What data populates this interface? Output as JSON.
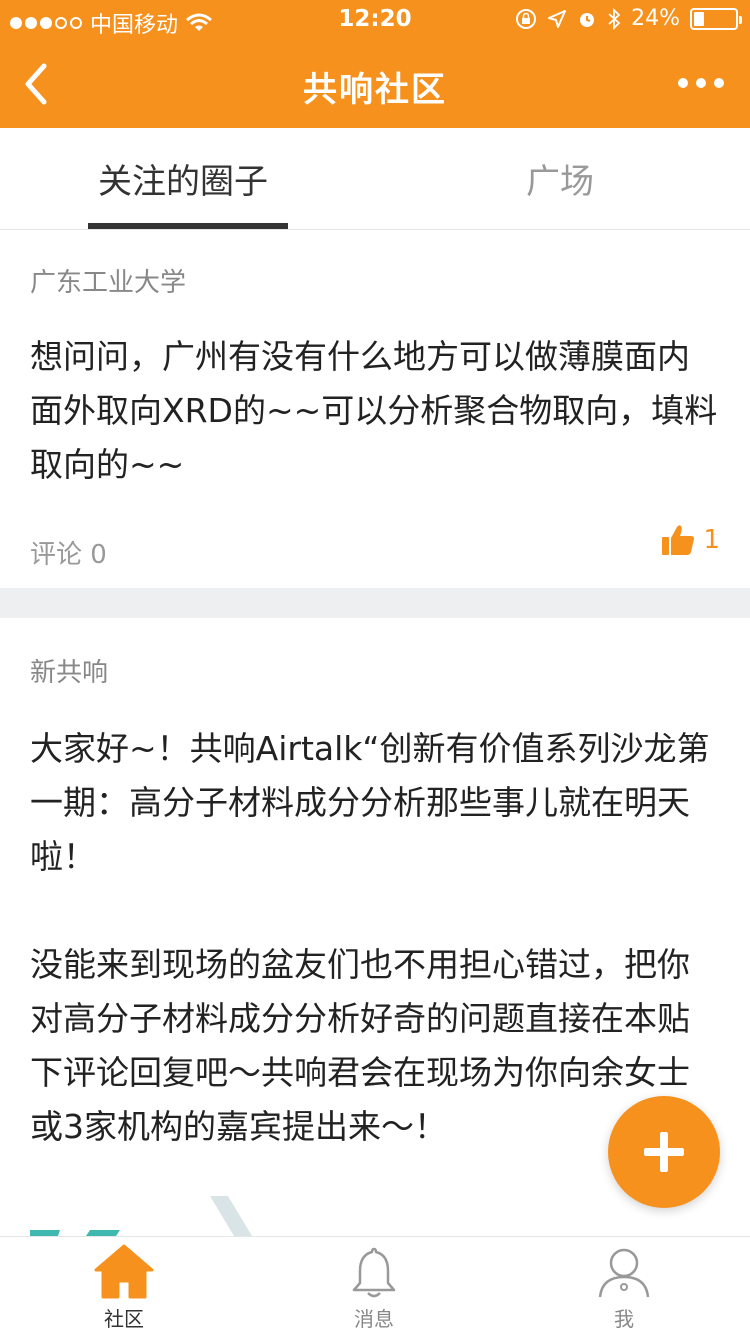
{
  "status_bar": {
    "carrier": "中国移动",
    "time": "12:20",
    "battery": "24%",
    "battery_level": 0.24
  },
  "header": {
    "title": "共响社区"
  },
  "tabs": [
    {
      "label": "关注的圈子",
      "active": true
    },
    {
      "label": "广场",
      "active": false
    }
  ],
  "posts": [
    {
      "circle": "广东工业大学",
      "paragraphs": [
        "想问问，广州有没有什么地方可以做薄膜面内面外取向XRD的~~可以分析聚合物取向，填料取向的~~"
      ],
      "comments": "评论 0",
      "likes": "1"
    },
    {
      "circle": "新共响",
      "paragraphs": [
        "大家好~！共响Airtalk“创新有价值系列沙龙第一期：高分子材料成分分析那些事儿就在明天啦！",
        "没能来到现场的盆友们也不用担心错过，把你对高分子材料成分分析好奇的问题直接在本贴下评论回复吧～共响君会在现场为你向余女士或3家机构的嘉宾提出来～！"
      ]
    }
  ],
  "bottom_tabs": [
    {
      "label": "社区",
      "icon": "home-icon",
      "active": true
    },
    {
      "label": "消息",
      "icon": "bell-icon",
      "active": false
    },
    {
      "label": "我",
      "icon": "user-icon",
      "active": false
    }
  ],
  "colors": {
    "accent": "#f7911e",
    "text": "#222222",
    "muted": "#999999",
    "divider": "#eeeff1"
  }
}
